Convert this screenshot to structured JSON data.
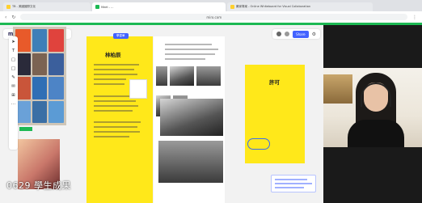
{
  "browser": {
    "tabs": [
      {
        "label": "TB - 美國國際文化"
      },
      {
        "label": "Meet - ..."
      },
      {
        "label": "贏家專案 - Online Whiteboard for Visual Collaboration"
      }
    ],
    "url": "miro.com"
  },
  "miro": {
    "logo": "miro",
    "board_name": "贏家專案",
    "share_label": "Share",
    "doc_tag": "學習單",
    "doc_title": "林柏辰",
    "card_title": "許可"
  },
  "caption": "0629 學生成果",
  "colors": {
    "accent": "#4262ff",
    "sticky": "#ffe81a",
    "green": "#1db954"
  }
}
